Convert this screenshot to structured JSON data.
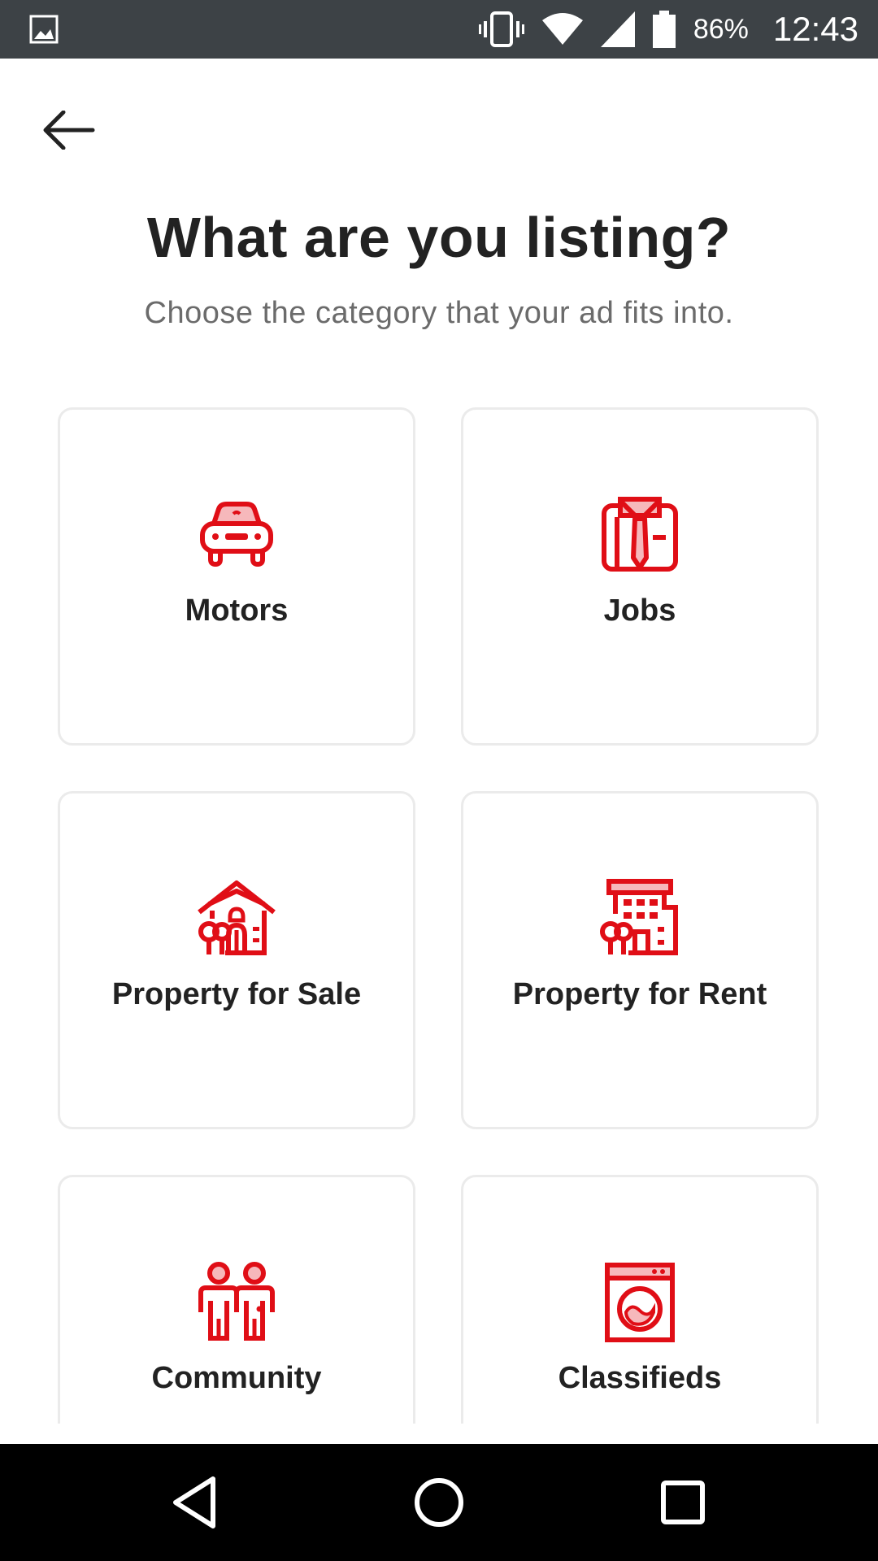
{
  "status_bar": {
    "battery_percent": "86%",
    "time": "12:43",
    "icons": [
      "image-notification-icon",
      "vibrate-icon",
      "wifi-icon",
      "cellular-signal-icon",
      "battery-icon"
    ]
  },
  "header": {
    "back_icon": "arrow-left-icon",
    "title": "What are you listing?",
    "subtitle": "Choose the category that your ad fits into."
  },
  "categories": [
    {
      "label": "Motors",
      "icon": "car-icon"
    },
    {
      "label": "Jobs",
      "icon": "shirt-tie-icon"
    },
    {
      "label": "Property for Sale",
      "icon": "house-icon"
    },
    {
      "label": "Property for Rent",
      "icon": "apartment-building-icon"
    },
    {
      "label": "Community",
      "icon": "people-icon"
    },
    {
      "label": "Classifieds",
      "icon": "washing-machine-icon"
    }
  ],
  "nav_bar": {
    "buttons": [
      "back-triangle-icon",
      "home-circle-icon",
      "recents-square-icon"
    ]
  },
  "colors": {
    "accent": "#e00e16",
    "status_bar_bg": "#3d4246",
    "card_border": "#ebebeb",
    "title_text": "#222222",
    "subtitle_text": "#6b6b6b"
  }
}
